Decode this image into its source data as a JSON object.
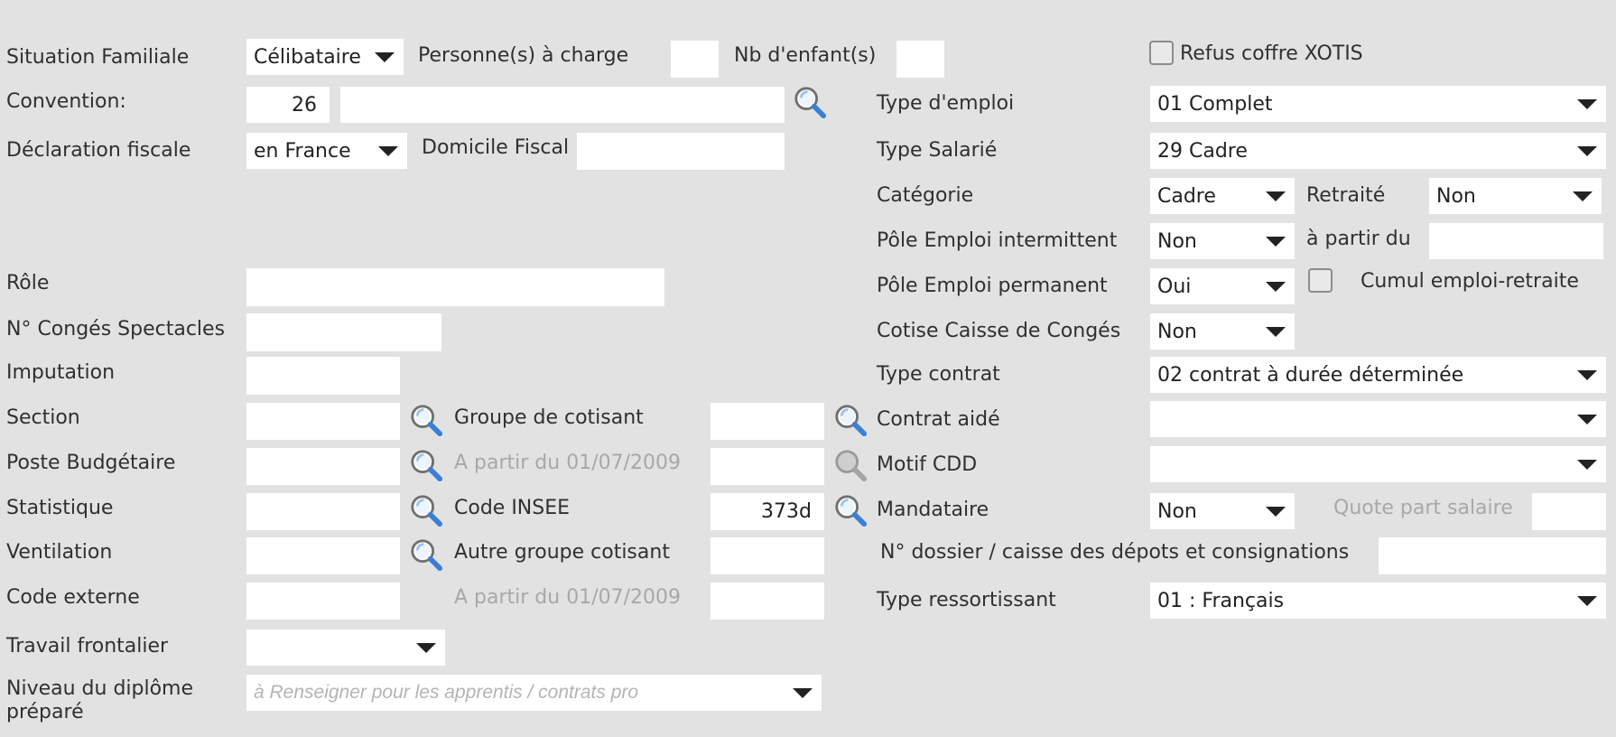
{
  "situation_familiale": {
    "label": "Situation Familiale",
    "value": "Célibataire"
  },
  "personnes_charge": {
    "label": "Personne(s) à charge",
    "value": ""
  },
  "nb_enfants": {
    "label": "Nb d'enfant(s)",
    "value": ""
  },
  "refus_coffre": {
    "label": "Refus coffre XOTIS",
    "checked": false
  },
  "convention": {
    "label": "Convention:",
    "code": "26",
    "name": ""
  },
  "type_emploi": {
    "label": "Type d'emploi",
    "value": "01 Complet"
  },
  "declaration_fiscale": {
    "label": "Déclaration fiscale",
    "value": "en France"
  },
  "domicile_fiscal": {
    "label": "Domicile Fiscal",
    "value": ""
  },
  "type_salarie": {
    "label": "Type Salarié",
    "value": "29 Cadre"
  },
  "categorie": {
    "label": "Catégorie",
    "value": "Cadre"
  },
  "retraite": {
    "label": "Retraité",
    "value": "Non"
  },
  "pole_intermittent": {
    "label": "Pôle Emploi intermittent",
    "value": "Non"
  },
  "a_partir_du": {
    "label": "à partir du",
    "value": ""
  },
  "role": {
    "label": "Rôle",
    "value": ""
  },
  "pole_permanent": {
    "label": "Pôle Emploi permanent",
    "value": "Oui"
  },
  "cumul_emploi": {
    "label": "Cumul emploi-retraite",
    "checked": false
  },
  "conges_spectacles": {
    "label": "N° Congés Spectacles",
    "value": ""
  },
  "cotise_caisse": {
    "label": "Cotise Caisse de Congés",
    "value": "Non"
  },
  "imputation": {
    "label": "Imputation",
    "value": ""
  },
  "type_contrat": {
    "label": "Type contrat",
    "value": "02 contrat à durée déterminée"
  },
  "section": {
    "label": "Section",
    "value": ""
  },
  "groupe_cotisant": {
    "label": "Groupe de cotisant",
    "value": ""
  },
  "contrat_aide": {
    "label": "Contrat aidé",
    "value": ""
  },
  "poste_budgetaire": {
    "label": "Poste Budgétaire",
    "value": ""
  },
  "a_partir_1": {
    "label": "A partir du 01/07/2009",
    "value": ""
  },
  "motif_cdd": {
    "label": "Motif CDD",
    "value": ""
  },
  "statistique": {
    "label": "Statistique",
    "value": ""
  },
  "code_insee": {
    "label": "Code INSEE",
    "value": "373d"
  },
  "mandataire": {
    "label": "Mandataire",
    "value": "Non"
  },
  "quote_part": {
    "label": "Quote part salaire",
    "value": ""
  },
  "ventilation": {
    "label": "Ventilation",
    "value": ""
  },
  "autre_groupe": {
    "label": "Autre groupe cotisant",
    "value": ""
  },
  "dossier_caisse": {
    "label": "N° dossier / caisse des dépots et consignations",
    "value": ""
  },
  "code_externe": {
    "label": "Code externe",
    "value": ""
  },
  "a_partir_2": {
    "label": "A partir du 01/07/2009",
    "value": ""
  },
  "type_ressortissant": {
    "label": "Type ressortissant",
    "value": "01 : Français"
  },
  "travail_frontalier": {
    "label": "Travail frontalier",
    "value": ""
  },
  "niveau_diplome": {
    "label": "Niveau du diplôme préparé",
    "placeholder": "à Renseigner pour les apprentis / contrats pro"
  },
  "icons": {
    "lookup": "magnifier-icon",
    "dropdown": "caret-down-icon",
    "checkbox": "checkbox-icon"
  },
  "colors": {
    "background": "#e2e2e2",
    "field": "#ffffff",
    "text": "#303030",
    "disabled_text": "#a8a8a8",
    "lens": "#3b7fd4"
  }
}
